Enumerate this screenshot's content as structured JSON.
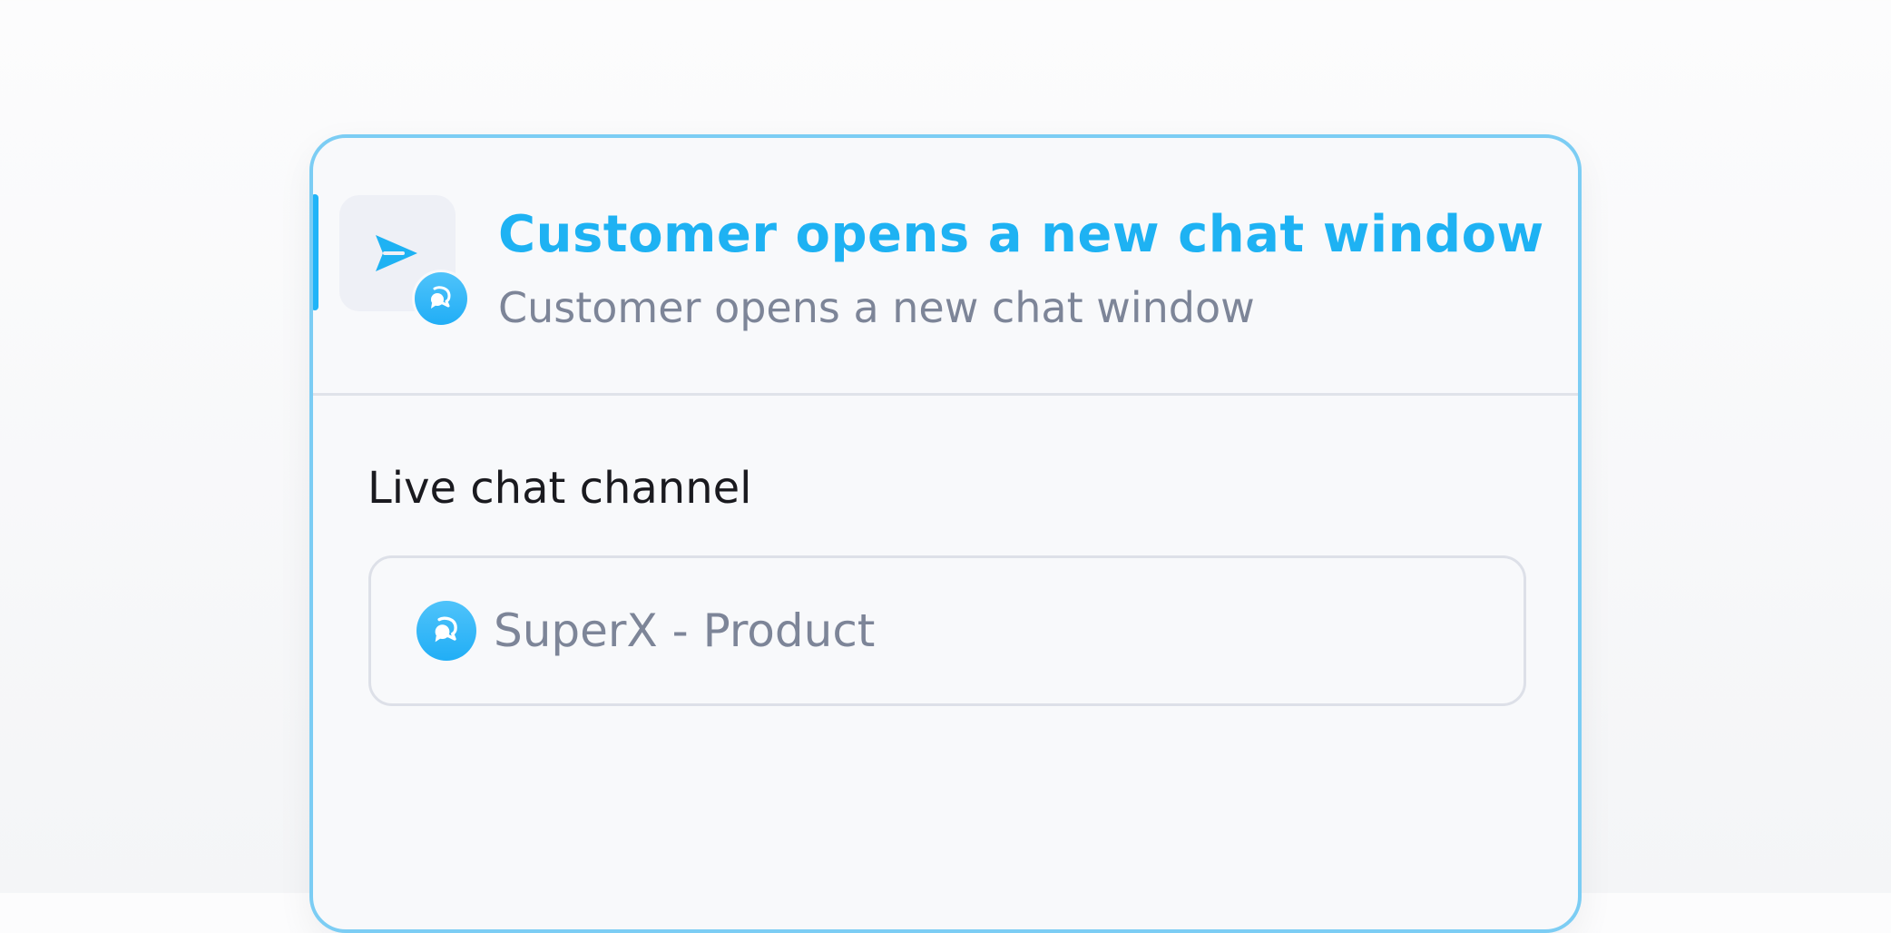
{
  "colors": {
    "accent": "#1eb2f3",
    "card_border": "#7ccdf4",
    "muted_text": "#7d8598",
    "dark_text": "#1a1a1f",
    "divider": "#e0e3ea"
  },
  "trigger": {
    "icon": "send-icon",
    "badge_icon": "chat-bubbles-icon",
    "title": "Customer opens a new chat window",
    "description": "Customer opens a new chat window"
  },
  "channel": {
    "label": "Live chat channel",
    "selected_value": "SuperX - Product",
    "icon": "chat-bubbles-icon"
  }
}
